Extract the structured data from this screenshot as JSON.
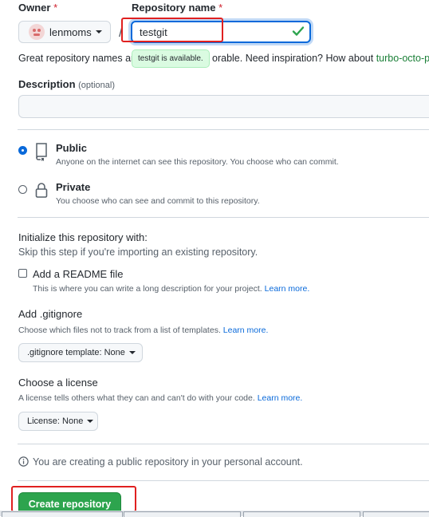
{
  "owner": {
    "label": "Owner",
    "required_mark": "*",
    "value": "lenmoms"
  },
  "repo": {
    "label": "Repository name",
    "required_mark": "*",
    "slash": "/",
    "value": "testgit",
    "tooltip": "testgit is available.",
    "hint_start": "Great repository names ar",
    "hint_end": "orable. Need inspiration? How about",
    "suggestion": "turbo-octo-p"
  },
  "description": {
    "label": "Description",
    "optional": "(optional)",
    "value": ""
  },
  "visibility": {
    "public": {
      "title": "Public",
      "desc": "Anyone on the internet can see this repository. You choose who can commit.",
      "selected": true
    },
    "private": {
      "title": "Private",
      "desc": "You choose who can see and commit to this repository.",
      "selected": false
    }
  },
  "init": {
    "heading": "Initialize this repository with:",
    "subtitle": "Skip this step if you're importing an existing repository.",
    "readme": {
      "label": "Add a README file",
      "desc": "This is where you can write a long description for your project.",
      "link": "Learn more.",
      "checked": false
    }
  },
  "gitignore": {
    "heading": "Add .gitignore",
    "desc": "Choose which files not to track from a list of templates.",
    "link": "Learn more.",
    "button": ".gitignore template: None"
  },
  "license": {
    "heading": "Choose a license",
    "desc": "A license tells others what they can and can't do with your code.",
    "link": "Learn more.",
    "button": "License: None"
  },
  "notice": "You are creating a public repository in your personal account.",
  "submit": {
    "label": "Create repository"
  },
  "colors": {
    "primary_green": "#2da44e",
    "accent_blue": "#0969da",
    "highlight_red": "#e02020"
  }
}
